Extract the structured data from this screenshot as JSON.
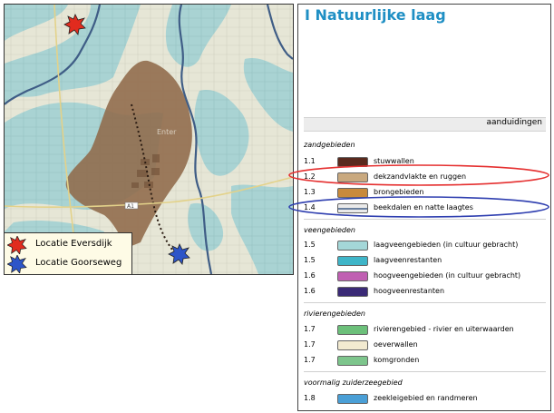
{
  "colors": {
    "water_bg": "#a9d3d3",
    "land_bg": "#e8e8d8",
    "brown_area": "#8f6a4a",
    "river": "#3f5d86",
    "road": "#e3d28a",
    "red_marker": "#e12b1e",
    "blue_marker": "#2d55c8",
    "legend_title": "#1f8fc4",
    "highlight_red": "#e53030",
    "highlight_blue": "#2f3fb0"
  },
  "map": {
    "place_label": "Enter",
    "road_label": "A1",
    "locations": [
      {
        "label": "Locatie Eversdijk",
        "marker_icon": "red-star-icon"
      },
      {
        "label": "Locatie Goorseweg",
        "marker_icon": "blue-star-icon"
      }
    ]
  },
  "legend": {
    "title": "I Natuurlijke laag",
    "header": "aanduidingen",
    "groups": [
      {
        "title": "zandgebieden",
        "items": [
          {
            "code": "1.1",
            "label": "stuwwallen",
            "swatch": "#5a2a1e"
          },
          {
            "code": "1.2",
            "label": "dekzandvlakte en ruggen",
            "swatch": "#c9a97f"
          },
          {
            "code": "1.3",
            "label": "brongebieden",
            "swatch": "#c88a3c"
          },
          {
            "code": "1.4",
            "label": "beekdalen en natte laagtes",
            "swatch": "#eaeaea"
          }
        ]
      },
      {
        "title": "veengebieden",
        "items": [
          {
            "code": "1.5",
            "label": "laagveengebieden (in cultuur gebracht)",
            "swatch": "#a4d7d8"
          },
          {
            "code": "1.5",
            "label": "laagveenrestanten",
            "swatch": "#3fb5c8"
          },
          {
            "code": "1.6",
            "label": "hoogveengebieden (in cultuur gebracht)",
            "swatch": "#c05fb2"
          },
          {
            "code": "1.6",
            "label": "hoogveenrestanten",
            "swatch": "#3a2a76"
          }
        ]
      },
      {
        "title": "rivierengebieden",
        "items": [
          {
            "code": "1.7",
            "label": "rivierengebied - rivier en uiterwaarden",
            "swatch": "#6cc07a"
          },
          {
            "code": "1.7",
            "label": "oeverwallen",
            "swatch": "#f2ead0"
          },
          {
            "code": "1.7",
            "label": "komgronden",
            "swatch": "#7dc58c"
          }
        ]
      },
      {
        "title": "voormalig zuiderzeegebied",
        "items": [
          {
            "code": "1.8",
            "label": "zeekleigebied en randmeren",
            "swatch": "#4a9fd6"
          }
        ]
      }
    ]
  }
}
